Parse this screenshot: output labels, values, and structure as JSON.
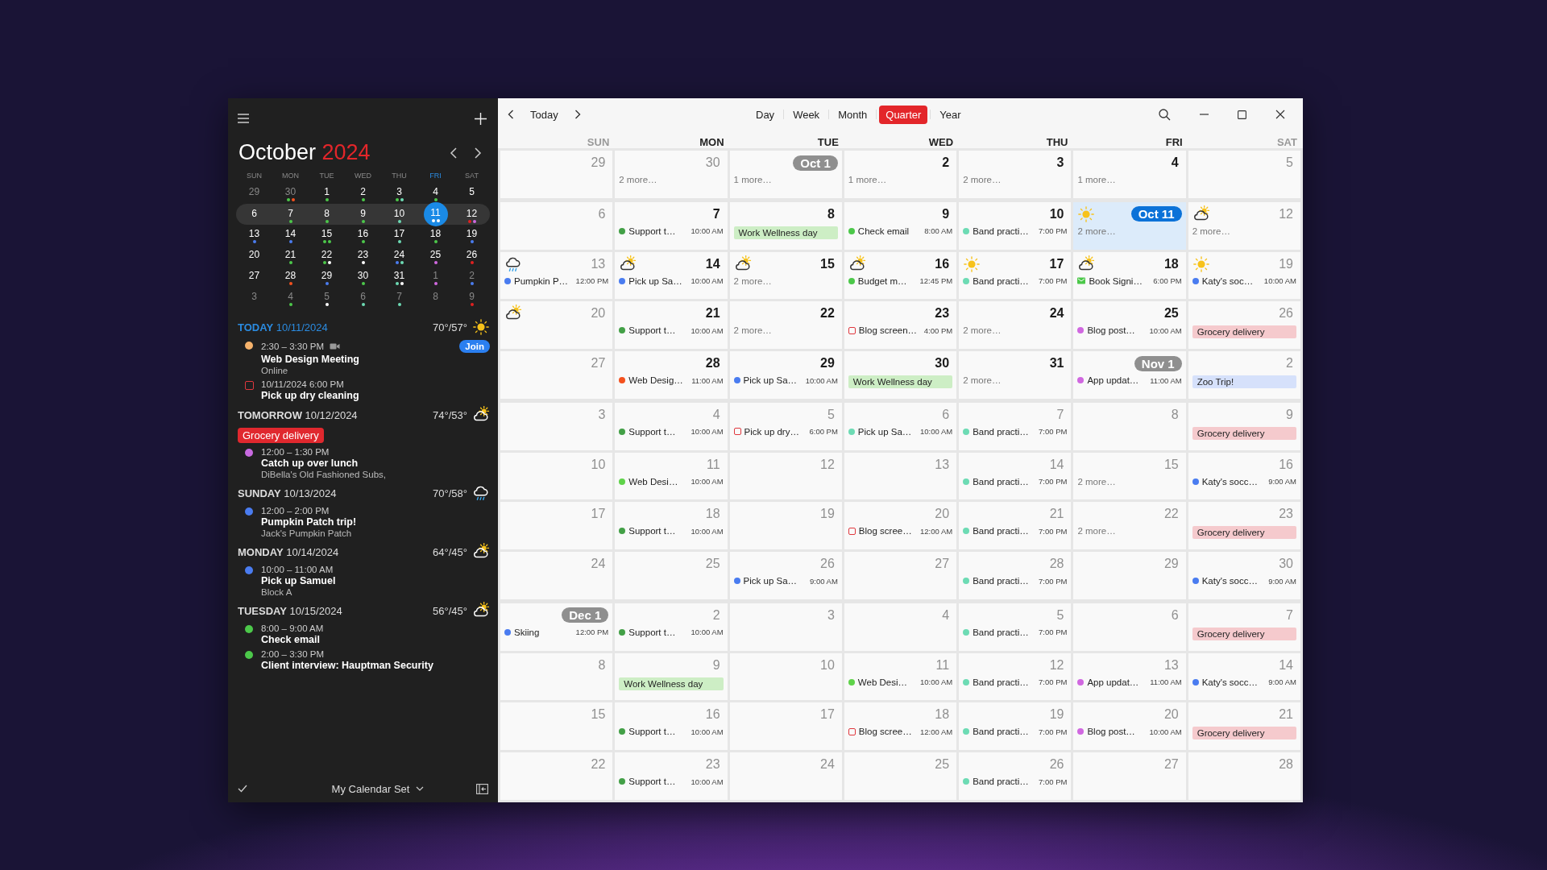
{
  "toolbar": {
    "today": "Today",
    "views": [
      {
        "label": "Day",
        "selected": false
      },
      {
        "label": "Week",
        "selected": false
      },
      {
        "label": "Month",
        "selected": false
      },
      {
        "label": "Quarter",
        "selected": true
      },
      {
        "label": "Year",
        "selected": false
      }
    ]
  },
  "sidebar": {
    "month": "October",
    "year": "2024",
    "weekdays": [
      {
        "label": "SUN",
        "today": false
      },
      {
        "label": "MON",
        "today": false
      },
      {
        "label": "TUE",
        "today": false
      },
      {
        "label": "WED",
        "today": false
      },
      {
        "label": "THU",
        "today": false
      },
      {
        "label": "FRI",
        "today": true
      },
      {
        "label": "SAT",
        "today": false
      }
    ],
    "weeks": [
      {
        "current": false,
        "days": [
          {
            "day": "29",
            "muted": true
          },
          {
            "day": "30",
            "muted": true,
            "dots": [
              {
                "color": "#4cc84a"
              },
              {
                "color": "#f4511e"
              }
            ]
          },
          {
            "day": "1",
            "muted": false,
            "dots": [
              {
                "color": "#4cc84a"
              }
            ]
          },
          {
            "day": "2",
            "muted": false,
            "dots": [
              {
                "color": "#4cc84a"
              }
            ]
          },
          {
            "day": "3",
            "muted": false,
            "dots": [
              {
                "color": "#4cc84a"
              },
              {
                "color": "#6ddbb4"
              }
            ]
          },
          {
            "day": "4",
            "muted": false,
            "dots": [
              {
                "color": "#4cc84a"
              }
            ]
          },
          {
            "day": "5",
            "muted": false
          }
        ]
      },
      {
        "current": true,
        "days": [
          {
            "day": "6",
            "muted": false
          },
          {
            "day": "7",
            "muted": false,
            "dots": [
              {
                "color": "#4cc84a"
              }
            ]
          },
          {
            "day": "8",
            "muted": false,
            "dots": [
              {
                "color": "#4cc84a"
              }
            ]
          },
          {
            "day": "9",
            "muted": false,
            "dots": [
              {
                "color": "#4cc84a"
              }
            ]
          },
          {
            "day": "10",
            "muted": false,
            "dots": [
              {
                "color": "#6ddbb4"
              }
            ]
          },
          {
            "day": "11",
            "muted": false,
            "today": true,
            "dots": [
              {
                "color": "#ffffff"
              },
              {
                "color": "#ffffff"
              }
            ]
          },
          {
            "day": "12",
            "muted": false,
            "dots": [
              {
                "color": "#e02020"
              },
              {
                "color": "#d068e0"
              }
            ]
          }
        ]
      },
      {
        "current": false,
        "days": [
          {
            "day": "13",
            "muted": false,
            "dots": [
              {
                "color": "#4a7cf0"
              }
            ]
          },
          {
            "day": "14",
            "muted": false,
            "dots": [
              {
                "color": "#4a7cf0"
              }
            ]
          },
          {
            "day": "15",
            "muted": false,
            "dots": [
              {
                "color": "#4cc84a"
              },
              {
                "color": "#4cc84a"
              }
            ]
          },
          {
            "day": "16",
            "muted": false,
            "dots": [
              {
                "color": "#4cc84a"
              }
            ]
          },
          {
            "day": "17",
            "muted": false,
            "dots": [
              {
                "color": "#6ddbb4"
              }
            ]
          },
          {
            "day": "18",
            "muted": false,
            "dots": [
              {
                "color": "#4cc84a"
              }
            ]
          },
          {
            "day": "19",
            "muted": false,
            "dots": [
              {
                "color": "#4a7cf0"
              }
            ]
          }
        ]
      },
      {
        "current": false,
        "days": [
          {
            "day": "20",
            "muted": false
          },
          {
            "day": "21",
            "muted": false,
            "dots": [
              {
                "color": "#4cc84a"
              }
            ]
          },
          {
            "day": "22",
            "muted": false,
            "dots": [
              {
                "color": "#4cc84a"
              },
              {
                "color": "#ffffff"
              }
            ]
          },
          {
            "day": "23",
            "muted": false,
            "dots": [
              {
                "color": "#ffffff"
              }
            ]
          },
          {
            "day": "24",
            "muted": false,
            "dots": [
              {
                "color": "#4a7cf0"
              },
              {
                "color": "#6ddbb4"
              }
            ]
          },
          {
            "day": "25",
            "muted": false,
            "dots": [
              {
                "color": "#d068e0"
              }
            ]
          },
          {
            "day": "26",
            "muted": false,
            "dots": [
              {
                "color": "#e02020"
              }
            ]
          }
        ]
      },
      {
        "current": false,
        "days": [
          {
            "day": "27",
            "muted": false
          },
          {
            "day": "28",
            "muted": false,
            "dots": [
              {
                "color": "#f4511e"
              }
            ]
          },
          {
            "day": "29",
            "muted": false,
            "dots": [
              {
                "color": "#4a7cf0"
              }
            ]
          },
          {
            "day": "30",
            "muted": false,
            "dots": [
              {
                "color": "#4cc84a"
              }
            ]
          },
          {
            "day": "31",
            "muted": false,
            "dots": [
              {
                "color": "#6ddbb4"
              },
              {
                "color": "#ffffff"
              }
            ]
          },
          {
            "day": "1",
            "muted": true,
            "dots": [
              {
                "color": "#d068e0"
              }
            ]
          },
          {
            "day": "2",
            "muted": true,
            "dots": [
              {
                "color": "#4a7cf0"
              }
            ]
          }
        ]
      },
      {
        "current": false,
        "days": [
          {
            "day": "3",
            "muted": true
          },
          {
            "day": "4",
            "muted": true,
            "dots": [
              {
                "color": "#4cc84a"
              }
            ]
          },
          {
            "day": "5",
            "muted": true,
            "dots": [
              {
                "color": "#ffffff"
              }
            ]
          },
          {
            "day": "6",
            "muted": true,
            "dots": [
              {
                "color": "#6ddbb4"
              }
            ]
          },
          {
            "day": "7",
            "muted": true,
            "dots": [
              {
                "color": "#6ddbb4"
              }
            ]
          },
          {
            "day": "8",
            "muted": true
          },
          {
            "day": "9",
            "muted": true,
            "dots": [
              {
                "color": "#e02020"
              }
            ]
          }
        ]
      }
    ],
    "agenda": [
      {
        "label": "TODAY",
        "date": "10/11/2024",
        "today": true,
        "temp": "70°/57°",
        "weather": {
          "kind": "sunny"
        },
        "events": [
          {
            "kind": "event",
            "color": "#f5b26b",
            "time": "2:30 – 3:30 PM",
            "video": true,
            "join": "Join",
            "title": "Web Design Meeting",
            "location": "Online"
          },
          {
            "kind": "task",
            "done": false,
            "time": "10/11/2024 6:00 PM",
            "title": "Pick up dry cleaning"
          }
        ]
      },
      {
        "label": "TOMORROW",
        "date": "10/12/2024",
        "today": false,
        "temp": "74°/53°",
        "weather": {
          "kind": "partly_cloudy"
        },
        "all_day": [
          {
            "title": "Grocery delivery",
            "color": "#e0282e"
          }
        ],
        "events": [
          {
            "kind": "event",
            "color": "#c86ae0",
            "time": "12:00 – 1:30 PM",
            "video": false,
            "title": "Catch up over lunch",
            "location": "DiBella's Old Fashioned Subs,"
          }
        ]
      },
      {
        "label": "SUNDAY",
        "date": "10/13/2024",
        "today": false,
        "temp": "70°/58°",
        "weather": {
          "kind": "rain"
        },
        "events": [
          {
            "kind": "event",
            "color": "#4a7cf0",
            "time": "12:00 – 2:00 PM",
            "video": false,
            "title": "Pumpkin Patch trip!",
            "location": "Jack's Pumpkin Patch"
          }
        ]
      },
      {
        "label": "MONDAY",
        "date": "10/14/2024",
        "today": false,
        "temp": "64°/45°",
        "weather": {
          "kind": "partly_cloudy"
        },
        "events": [
          {
            "kind": "event",
            "color": "#4a7cf0",
            "time": "10:00 – 11:00 AM",
            "video": false,
            "title": "Pick up Samuel",
            "location": "Block A"
          }
        ]
      },
      {
        "label": "TUESDAY",
        "date": "10/15/2024",
        "today": false,
        "temp": "56°/45°",
        "weather": {
          "kind": "partly_cloudy"
        },
        "events": [
          {
            "kind": "event",
            "color": "#4cc84a",
            "time": "8:00 – 9:00 AM",
            "video": false,
            "title": "Check email"
          },
          {
            "kind": "event",
            "color": "#4cc84a",
            "time": "2:00 – 3:30 PM",
            "video": false,
            "title": "Client interview: Hauptman Security"
          }
        ]
      }
    ],
    "calendar_set": "My Calendar Set"
  },
  "grid": {
    "weekdays": [
      {
        "label": "SUN",
        "dim": true
      },
      {
        "label": "MON",
        "dim": false
      },
      {
        "label": "TUE",
        "dim": false
      },
      {
        "label": "WED",
        "dim": false
      },
      {
        "label": "THU",
        "dim": false
      },
      {
        "label": "FRI",
        "dim": false
      },
      {
        "label": "SAT",
        "dim": true
      }
    ],
    "weeks": [
      {
        "thick_top": false,
        "cells": [
          {
            "day": "29",
            "dim": true
          },
          {
            "day": "30",
            "dim": true,
            "items": [
              {
                "kind": "more",
                "title": "2 more…"
              }
            ]
          },
          {
            "day": "Oct 1",
            "badge": true,
            "items": [
              {
                "kind": "more",
                "title": "1 more…"
              }
            ]
          },
          {
            "day": "2",
            "dim": false,
            "items": [
              {
                "kind": "more",
                "title": "1 more…"
              }
            ]
          },
          {
            "day": "3",
            "dim": false,
            "items": [
              {
                "kind": "more",
                "title": "2 more…"
              }
            ]
          },
          {
            "day": "4",
            "dim": false,
            "items": [
              {
                "kind": "more",
                "title": "1 more…"
              }
            ]
          },
          {
            "day": "5",
            "dim": true
          }
        ]
      },
      {
        "thick_top": true,
        "cells": [
          {
            "day": "6",
            "dim": true
          },
          {
            "day": "7",
            "dim": false,
            "items": [
              {
                "kind": "event",
                "title": "Support t…",
                "time": "10:00 AM",
                "color": "#43a047"
              }
            ]
          },
          {
            "day": "8",
            "dim": false,
            "items": [
              {
                "kind": "allday",
                "title": "Work Wellness day",
                "color": "#cdeec5"
              }
            ]
          },
          {
            "day": "9",
            "dim": false,
            "items": [
              {
                "kind": "event",
                "title": "Check email",
                "time": "8:00 AM",
                "color": "#4cc84a"
              }
            ]
          },
          {
            "day": "10",
            "dim": false,
            "items": [
              {
                "kind": "event",
                "title": "Band practi…",
                "time": "7:00 PM",
                "color": "#6ddbb4"
              }
            ]
          },
          {
            "day": "Oct 11",
            "badge": true,
            "today": true,
            "weather": {
              "kind": "sunny"
            },
            "items": [
              {
                "kind": "more",
                "title": "2 more…"
              }
            ]
          },
          {
            "day": "12",
            "dim": true,
            "weather": {
              "kind": "partly_cloudy"
            },
            "items": [
              {
                "kind": "more",
                "title": "2 more…"
              }
            ]
          }
        ]
      },
      {
        "thick_top": false,
        "cells": [
          {
            "day": "13",
            "dim": true,
            "weather": {
              "kind": "rain"
            },
            "items": [
              {
                "kind": "event",
                "title": "Pumpkin P…",
                "time": "12:00 PM",
                "color": "#4a7cf0"
              }
            ]
          },
          {
            "day": "14",
            "dim": false,
            "weather": {
              "kind": "partly_cloudy"
            },
            "items": [
              {
                "kind": "event",
                "title": "Pick up Sa…",
                "time": "10:00 AM",
                "color": "#4a7cf0"
              }
            ]
          },
          {
            "day": "15",
            "dim": false,
            "weather": {
              "kind": "partly_cloudy"
            },
            "items": [
              {
                "kind": "more",
                "title": "2 more…"
              }
            ]
          },
          {
            "day": "16",
            "dim": false,
            "weather": {
              "kind": "partly_cloudy"
            },
            "items": [
              {
                "kind": "event",
                "title": "Budget m…",
                "time": "12:45 PM",
                "color": "#4cc84a"
              }
            ]
          },
          {
            "day": "17",
            "dim": false,
            "weather": {
              "kind": "sunny"
            },
            "items": [
              {
                "kind": "event",
                "title": "Band practi…",
                "time": "7:00 PM",
                "color": "#6ddbb4"
              }
            ]
          },
          {
            "day": "18",
            "dim": false,
            "weather": {
              "kind": "partly_cloudy"
            },
            "items": [
              {
                "kind": "message",
                "title": "Book Signi…",
                "time": "6:00 PM",
                "color": "#4cc84a"
              }
            ]
          },
          {
            "day": "19",
            "dim": true,
            "weather": {
              "kind": "sunny"
            },
            "items": [
              {
                "kind": "event",
                "title": "Katy's soc…",
                "time": "10:00 AM",
                "color": "#4a7cf0"
              }
            ]
          }
        ]
      },
      {
        "thick_top": false,
        "cells": [
          {
            "day": "20",
            "dim": true,
            "weather": {
              "kind": "partly_cloudy"
            }
          },
          {
            "day": "21",
            "dim": false,
            "items": [
              {
                "kind": "event",
                "title": "Support t…",
                "time": "10:00 AM",
                "color": "#43a047"
              }
            ]
          },
          {
            "day": "22",
            "dim": false,
            "items": [
              {
                "kind": "more",
                "title": "2 more…"
              }
            ]
          },
          {
            "day": "23",
            "dim": false,
            "items": [
              {
                "kind": "task",
                "done": false,
                "title": "Blog screen…",
                "time": "4:00 PM"
              }
            ]
          },
          {
            "day": "24",
            "dim": false,
            "items": [
              {
                "kind": "more",
                "title": "2 more…"
              }
            ]
          },
          {
            "day": "25",
            "dim": false,
            "items": [
              {
                "kind": "event",
                "title": "Blog post…",
                "time": "10:00 AM",
                "color": "#d068e0"
              }
            ]
          },
          {
            "day": "26",
            "dim": true,
            "items": [
              {
                "kind": "allday",
                "title": "Grocery delivery",
                "color": "#f5cacd"
              }
            ]
          }
        ]
      },
      {
        "thick_top": false,
        "cells": [
          {
            "day": "27",
            "dim": true
          },
          {
            "day": "28",
            "dim": false,
            "items": [
              {
                "kind": "event",
                "title": "Web Desig…",
                "time": "11:00 AM",
                "color": "#f4511e"
              }
            ]
          },
          {
            "day": "29",
            "dim": false,
            "items": [
              {
                "kind": "event",
                "title": "Pick up Sa…",
                "time": "10:00 AM",
                "color": "#4a7cf0"
              }
            ]
          },
          {
            "day": "30",
            "dim": false,
            "items": [
              {
                "kind": "allday",
                "title": "Work Wellness day",
                "color": "#cdeec5"
              }
            ]
          },
          {
            "day": "31",
            "dim": false,
            "items": [
              {
                "kind": "more",
                "title": "2 more…"
              }
            ]
          },
          {
            "day": "Nov 1",
            "badge": true,
            "items": [
              {
                "kind": "event",
                "title": "App updat…",
                "time": "11:00 AM",
                "color": "#d068e0"
              }
            ]
          },
          {
            "day": "2",
            "dim": true,
            "items": [
              {
                "kind": "allday",
                "title": "Zoo Trip!",
                "color": "#d6e1fb"
              }
            ]
          }
        ]
      },
      {
        "thick_top": true,
        "cells": [
          {
            "day": "3",
            "dim": true
          },
          {
            "day": "4",
            "dim": true,
            "items": [
              {
                "kind": "event",
                "title": "Support t…",
                "time": "10:00 AM",
                "color": "#43a047"
              }
            ]
          },
          {
            "day": "5",
            "dim": true,
            "items": [
              {
                "kind": "task",
                "done": false,
                "title": "Pick up dry…",
                "time": "6:00 PM"
              }
            ]
          },
          {
            "day": "6",
            "dim": true,
            "items": [
              {
                "kind": "event",
                "title": "Pick up Sa…",
                "time": "10:00 AM",
                "color": "#6ddbb4"
              }
            ]
          },
          {
            "day": "7",
            "dim": true,
            "items": [
              {
                "kind": "event",
                "title": "Band practi…",
                "time": "7:00 PM",
                "color": "#6ddbb4"
              }
            ]
          },
          {
            "day": "8",
            "dim": true
          },
          {
            "day": "9",
            "dim": true,
            "items": [
              {
                "kind": "allday",
                "title": "Grocery delivery",
                "color": "#f5cacd"
              }
            ]
          }
        ]
      },
      {
        "thick_top": false,
        "cells": [
          {
            "day": "10",
            "dim": true
          },
          {
            "day": "11",
            "dim": true,
            "items": [
              {
                "kind": "event",
                "title": "Web Desi…",
                "time": "10:00 AM",
                "color": "#5fd34a"
              }
            ]
          },
          {
            "day": "12",
            "dim": true
          },
          {
            "day": "13",
            "dim": true
          },
          {
            "day": "14",
            "dim": true,
            "items": [
              {
                "kind": "event",
                "title": "Band practi…",
                "time": "7:00 PM",
                "color": "#6ddbb4"
              }
            ]
          },
          {
            "day": "15",
            "dim": true,
            "items": [
              {
                "kind": "more",
                "title": "2 more…"
              }
            ]
          },
          {
            "day": "16",
            "dim": true,
            "items": [
              {
                "kind": "event",
                "title": "Katy's socc…",
                "time": "9:00 AM",
                "color": "#4a7cf0"
              }
            ]
          }
        ]
      },
      {
        "thick_top": false,
        "cells": [
          {
            "day": "17",
            "dim": true
          },
          {
            "day": "18",
            "dim": true,
            "items": [
              {
                "kind": "event",
                "title": "Support t…",
                "time": "10:00 AM",
                "color": "#43a047"
              }
            ]
          },
          {
            "day": "19",
            "dim": true
          },
          {
            "day": "20",
            "dim": true,
            "items": [
              {
                "kind": "task",
                "done": false,
                "title": "Blog scree…",
                "time": "12:00 AM"
              }
            ]
          },
          {
            "day": "21",
            "dim": true,
            "items": [
              {
                "kind": "event",
                "title": "Band practi…",
                "time": "7:00 PM",
                "color": "#6ddbb4"
              }
            ]
          },
          {
            "day": "22",
            "dim": true,
            "items": [
              {
                "kind": "more",
                "title": "2 more…"
              }
            ]
          },
          {
            "day": "23",
            "dim": true,
            "items": [
              {
                "kind": "allday",
                "title": "Grocery delivery",
                "color": "#f5cacd"
              }
            ]
          }
        ]
      },
      {
        "thick_top": false,
        "cells": [
          {
            "day": "24",
            "dim": true
          },
          {
            "day": "25",
            "dim": true
          },
          {
            "day": "26",
            "dim": true,
            "items": [
              {
                "kind": "event",
                "title": "Pick up Sa…",
                "time": "9:00 AM",
                "color": "#4a7cf0"
              }
            ]
          },
          {
            "day": "27",
            "dim": true
          },
          {
            "day": "28",
            "dim": true,
            "items": [
              {
                "kind": "event",
                "title": "Band practi…",
                "time": "7:00 PM",
                "color": "#6ddbb4"
              }
            ]
          },
          {
            "day": "29",
            "dim": true
          },
          {
            "day": "30",
            "dim": true,
            "items": [
              {
                "kind": "event",
                "title": "Katy's socc…",
                "time": "9:00 AM",
                "color": "#4a7cf0"
              }
            ]
          }
        ]
      },
      {
        "thick_top": true,
        "cells": [
          {
            "day": "Dec 1",
            "badge": true,
            "items": [
              {
                "kind": "event",
                "title": "Skiing",
                "time": "12:00 PM",
                "color": "#4a7cf0"
              }
            ]
          },
          {
            "day": "2",
            "dim": true,
            "items": [
              {
                "kind": "event",
                "title": "Support t…",
                "time": "10:00 AM",
                "color": "#43a047"
              }
            ]
          },
          {
            "day": "3",
            "dim": true
          },
          {
            "day": "4",
            "dim": true
          },
          {
            "day": "5",
            "dim": true,
            "items": [
              {
                "kind": "event",
                "title": "Band practi…",
                "time": "7:00 PM",
                "color": "#6ddbb4"
              }
            ]
          },
          {
            "day": "6",
            "dim": true
          },
          {
            "day": "7",
            "dim": true,
            "items": [
              {
                "kind": "allday",
                "title": "Grocery delivery",
                "color": "#f5cacd"
              }
            ]
          }
        ]
      },
      {
        "thick_top": false,
        "cells": [
          {
            "day": "8",
            "dim": true
          },
          {
            "day": "9",
            "dim": true,
            "items": [
              {
                "kind": "allday",
                "title": "Work Wellness day",
                "color": "#cdeec5"
              }
            ]
          },
          {
            "day": "10",
            "dim": true
          },
          {
            "day": "11",
            "dim": true,
            "items": [
              {
                "kind": "event",
                "title": "Web Desi…",
                "time": "10:00 AM",
                "color": "#5fd34a"
              }
            ]
          },
          {
            "day": "12",
            "dim": true,
            "items": [
              {
                "kind": "event",
                "title": "Band practi…",
                "time": "7:00 PM",
                "color": "#6ddbb4"
              }
            ]
          },
          {
            "day": "13",
            "dim": true,
            "items": [
              {
                "kind": "event",
                "title": "App updat…",
                "time": "11:00 AM",
                "color": "#d068e0"
              }
            ]
          },
          {
            "day": "14",
            "dim": true,
            "items": [
              {
                "kind": "event",
                "title": "Katy's socc…",
                "time": "9:00 AM",
                "color": "#4a7cf0"
              }
            ]
          }
        ]
      },
      {
        "thick_top": false,
        "cells": [
          {
            "day": "15",
            "dim": true
          },
          {
            "day": "16",
            "dim": true,
            "items": [
              {
                "kind": "event",
                "title": "Support t…",
                "time": "10:00 AM",
                "color": "#43a047"
              }
            ]
          },
          {
            "day": "17",
            "dim": true
          },
          {
            "day": "18",
            "dim": true,
            "items": [
              {
                "kind": "task",
                "done": false,
                "title": "Blog scree…",
                "time": "12:00 AM"
              }
            ]
          },
          {
            "day": "19",
            "dim": true,
            "items": [
              {
                "kind": "event",
                "title": "Band practi…",
                "time": "7:00 PM",
                "color": "#6ddbb4"
              }
            ]
          },
          {
            "day": "20",
            "dim": true,
            "items": [
              {
                "kind": "event",
                "title": "Blog post…",
                "time": "10:00 AM",
                "color": "#d068e0"
              }
            ]
          },
          {
            "day": "21",
            "dim": true,
            "items": [
              {
                "kind": "allday",
                "title": "Grocery delivery",
                "color": "#f5cacd"
              }
            ]
          }
        ]
      },
      {
        "thick_top": false,
        "cells": [
          {
            "day": "22",
            "dim": true
          },
          {
            "day": "23",
            "dim": true,
            "items": [
              {
                "kind": "event",
                "title": "Support t…",
                "time": "10:00 AM",
                "color": "#43a047"
              }
            ]
          },
          {
            "day": "24",
            "dim": true
          },
          {
            "day": "25",
            "dim": true
          },
          {
            "day": "26",
            "dim": true,
            "items": [
              {
                "kind": "event",
                "title": "Band practi…",
                "time": "7:00 PM",
                "color": "#6ddbb4"
              }
            ]
          },
          {
            "day": "27",
            "dim": true
          },
          {
            "day": "28",
            "dim": true
          }
        ]
      }
    ]
  }
}
